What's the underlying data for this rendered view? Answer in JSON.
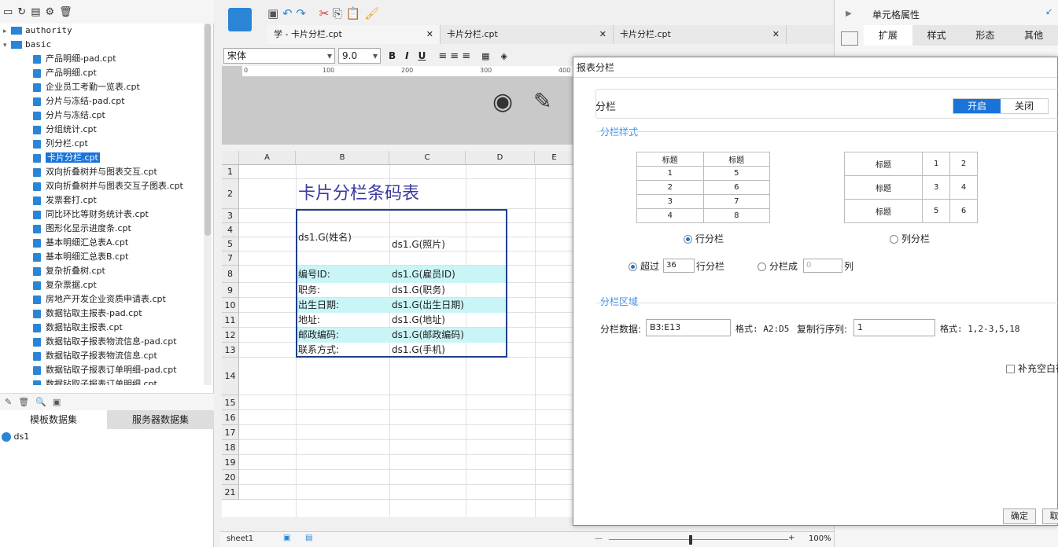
{
  "left": {
    "tree": [
      {
        "kind": "folder",
        "label": "authority",
        "indent": 0,
        "open": false
      },
      {
        "kind": "folder",
        "label": "basic",
        "indent": 0,
        "open": true
      },
      {
        "kind": "file",
        "label": "产品明细-pad.cpt"
      },
      {
        "kind": "file",
        "label": "产品明细.cpt"
      },
      {
        "kind": "file",
        "label": "企业员工考勤一览表.cpt"
      },
      {
        "kind": "file",
        "label": "分片与冻结-pad.cpt"
      },
      {
        "kind": "file",
        "label": "分片与冻结.cpt"
      },
      {
        "kind": "file",
        "label": "分组统计.cpt"
      },
      {
        "kind": "file",
        "label": "列分栏.cpt"
      },
      {
        "kind": "file",
        "label": "卡片分栏.cpt",
        "selected": true
      },
      {
        "kind": "file",
        "label": "双向折叠树并与图表交互.cpt"
      },
      {
        "kind": "file",
        "label": "双向折叠树并与图表交互子图表.cpt"
      },
      {
        "kind": "file",
        "label": "发票套打.cpt"
      },
      {
        "kind": "file",
        "label": "同比环比等财务统计表.cpt"
      },
      {
        "kind": "file",
        "label": "图形化显示进度条.cpt"
      },
      {
        "kind": "file",
        "label": "基本明细汇总表A.cpt"
      },
      {
        "kind": "file",
        "label": "基本明细汇总表B.cpt"
      },
      {
        "kind": "file",
        "label": "复杂折叠树.cpt"
      },
      {
        "kind": "file",
        "label": "复杂票据.cpt"
      },
      {
        "kind": "file",
        "label": "房地产开发企业资质申请表.cpt"
      },
      {
        "kind": "file",
        "label": "数据钻取主报表-pad.cpt"
      },
      {
        "kind": "file",
        "label": "数据钻取主报表.cpt"
      },
      {
        "kind": "file",
        "label": "数据钻取子报表物流信息-pad.cpt"
      },
      {
        "kind": "file",
        "label": "数据钻取子报表物流信息.cpt"
      },
      {
        "kind": "file",
        "label": "数据钻取子报表订单明细-pad.cpt"
      },
      {
        "kind": "file",
        "label": "数据钻取子报表订单明细.cpt"
      }
    ],
    "ds_tabs": [
      "模板数据集",
      "服务器数据集"
    ],
    "ds_item": "ds1"
  },
  "doc_tabs": [
    {
      "label": "学 - 卡片分栏.cpt"
    },
    {
      "label": "卡片分栏.cpt"
    },
    {
      "label": "卡片分栏.cpt"
    }
  ],
  "format": {
    "font": "宋体",
    "size": "9.0"
  },
  "ruler": {
    "t0": "0",
    "t100": "100",
    "t200": "200",
    "t300": "300",
    "t400": "400"
  },
  "grid": {
    "cols": [
      "A",
      "B",
      "C",
      "D",
      "E"
    ],
    "rows": [
      "1",
      "2",
      "3",
      "4",
      "5",
      "7",
      "8",
      "9",
      "10",
      "11",
      "12",
      "13",
      "14",
      "15",
      "16",
      "17",
      "18",
      "19",
      "20",
      "21"
    ],
    "title": "卡片分栏条码表",
    "name_cell": "ds1.G(姓名)",
    "photo_cell": "ds1.G(照片)",
    "fields": [
      {
        "label": "编号ID:",
        "value": "ds1.G(雇员ID)",
        "cyan": true
      },
      {
        "label": "职务:",
        "value": "ds1.G(职务)",
        "cyan": false
      },
      {
        "label": "出生日期:",
        "value": "ds1.G(出生日期)",
        "cyan": true
      },
      {
        "label": "地址:",
        "value": "ds1.G(地址)",
        "cyan": false
      },
      {
        "label": "邮政编码:",
        "value": "ds1.G(邮政编码)",
        "cyan": true
      },
      {
        "label": "联系方式:",
        "value": "ds1.G(手机)",
        "cyan": false
      }
    ]
  },
  "bottom": {
    "sheet": "sheet1",
    "zoom": "100%"
  },
  "right_panel": {
    "title": "单元格属性",
    "tabs": [
      "扩展",
      "样式",
      "形态",
      "其他"
    ]
  },
  "dialog": {
    "title": "报表分栏",
    "fenlan": "分栏",
    "on": "开启",
    "off": "关闭",
    "style_title": "分栏样式",
    "row_sample": {
      "header": [
        "标题",
        "标题"
      ],
      "rows": [
        [
          "1",
          "5"
        ],
        [
          "2",
          "6"
        ],
        [
          "3",
          "7"
        ],
        [
          "4",
          "8"
        ]
      ]
    },
    "col_sample": {
      "rows": [
        [
          "标题",
          "1",
          "2"
        ],
        [
          "标题",
          "3",
          "4"
        ],
        [
          "标题",
          "5",
          "6"
        ]
      ]
    },
    "row_mode": "行分栏",
    "col_mode": "列分栏",
    "exceed": "超过",
    "exceed_value": "36",
    "exceed_unit": "行分栏",
    "split_into": "分栏成",
    "split_value": "0",
    "split_unit": "列",
    "area_title": "分栏区域",
    "data_label": "分栏数据:",
    "data_value": "B3:E13",
    "format_label1": "格式: A2:D5",
    "copy_label": "复制行序列:",
    "copy_value": "1",
    "format_label2": "格式: 1,2-3,5,18",
    "fill_blank": "补充空白行",
    "ok": "确定",
    "cancel": "取"
  }
}
